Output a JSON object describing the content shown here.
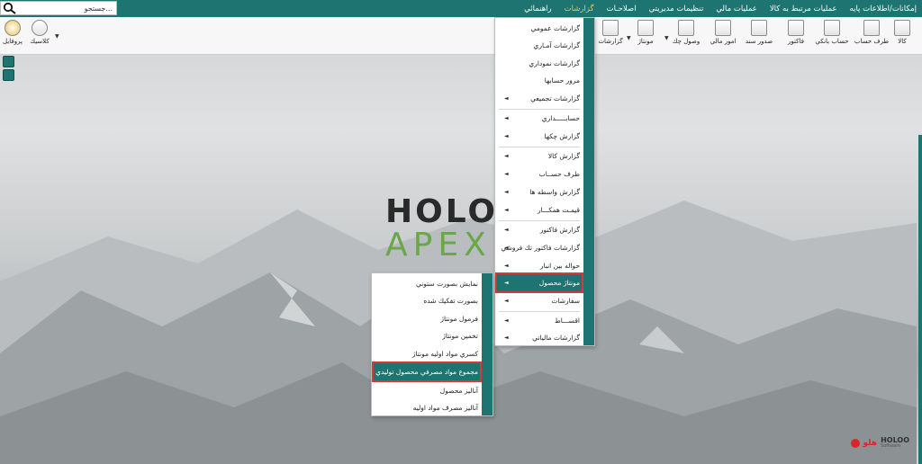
{
  "search": {
    "placeholder": "جستجو..."
  },
  "menubar": {
    "items": [
      "إمكانات/اطلاعات پايه",
      "عمليات مرتبط به كالا",
      "عمليات مالي",
      "تنظيمات مديريتي",
      "اصلاحـات",
      "گزارشات",
      "راهنمائي"
    ],
    "active": "گزارشات"
  },
  "toolbar": {
    "buttons": [
      {
        "label": "كالا",
        "icon": "box-icon"
      },
      {
        "label": "طرف حساب",
        "icon": "person-icon"
      },
      {
        "label": "حساب بانكي",
        "icon": "bank-icon"
      },
      {
        "label": "فاكتور",
        "icon": "invoice-icon"
      },
      {
        "label": "صدور سند",
        "icon": "document-icon"
      },
      {
        "label": "امور مالي",
        "icon": "finance-icon"
      },
      {
        "label": "وصول چك",
        "icon": "check-icon"
      },
      {
        "label": "مونتاژ",
        "icon": "assembly-icon"
      },
      {
        "label": "گزارشات",
        "icon": "report-icon"
      }
    ],
    "left_buttons": [
      {
        "label": "كلاسيك",
        "icon": "palette-icon"
      },
      {
        "label": "پروفايل",
        "icon": "profile-icon"
      }
    ]
  },
  "logo": {
    "top": "HOLOO",
    "bottom": "APEX",
    "brand_fa": "هلو",
    "brand_en": "HOLOO",
    "brand_sub": "Software"
  },
  "reports_menu": {
    "items": [
      {
        "label": "گزارشات عمومي",
        "submenu": false
      },
      {
        "label": "گزارشات آمـاري",
        "submenu": false
      },
      {
        "label": "گزارشات نموداري",
        "submenu": false
      },
      {
        "label": "مرور حسابها",
        "submenu": false
      },
      {
        "label": "گزارشات تجميعي",
        "submenu": true
      },
      {
        "label": "حسابـــــداري",
        "submenu": true
      },
      {
        "label": "گزارش چكها",
        "submenu": true
      },
      {
        "label": "گزارش كالا",
        "submenu": true
      },
      {
        "label": "طرف حســاب",
        "submenu": true
      },
      {
        "label": "گزارش واسطه ها",
        "submenu": true
      },
      {
        "label": "قيمـت همكـــار",
        "submenu": true
      },
      {
        "label": "گزارش فاكتور",
        "submenu": true
      },
      {
        "label": "گزارشات فاكتور تك فروشي",
        "submenu": true
      },
      {
        "label": "حواله بين انبار",
        "submenu": true
      },
      {
        "label": "مونتاژ محصول",
        "submenu": true,
        "highlighted": true
      },
      {
        "label": "سفارشات",
        "submenu": true
      },
      {
        "label": "اقســـاط",
        "submenu": true
      },
      {
        "label": "گزارشات مالياتي",
        "submenu": true
      }
    ]
  },
  "assembly_submenu": {
    "items": [
      {
        "label": "نمايش بصورت ستوني"
      },
      {
        "label": "بصورت تفكيك شده"
      },
      {
        "label": "فرمول مونتاژ"
      },
      {
        "label": "تخمين مونتاژ"
      },
      {
        "label": "كسري مواد اوليه مونتاژ"
      },
      {
        "label": "مجموع مواد مصرفي محصول توليدي",
        "highlighted": true
      },
      {
        "label": "آناليز محصول"
      },
      {
        "label": "آناليز مصرف مواد اوليه"
      }
    ]
  },
  "colors": {
    "accent": "#1e7470",
    "active_menu": "#f3c84b",
    "highlight_border": "#d13b3b",
    "logo_green": "#6aa64a",
    "brand_red": "#d8262c"
  }
}
